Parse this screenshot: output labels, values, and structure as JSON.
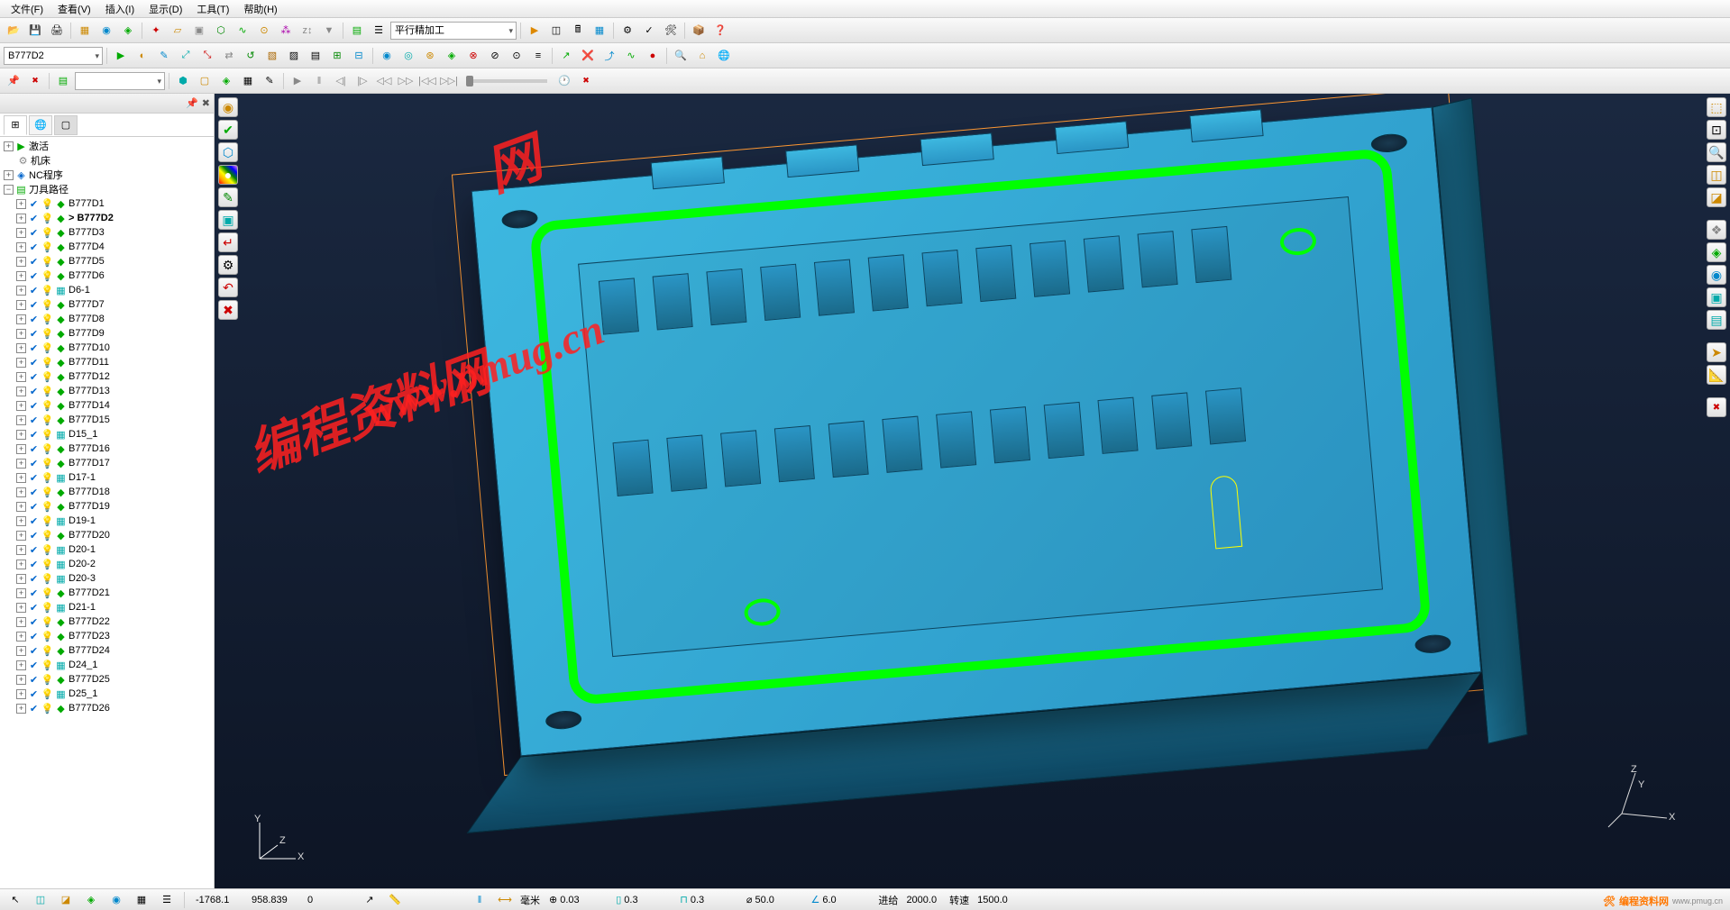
{
  "menu": {
    "file": "文件(F)",
    "view": "查看(V)",
    "insert": "插入(I)",
    "display": "显示(D)",
    "tools": "工具(T)",
    "help": "帮助(H)"
  },
  "toolbar2": {
    "combo1": "B777D2",
    "combo_strategy": "平行精加工"
  },
  "explorer": {
    "roots": {
      "activate": "激活",
      "machine": "机床",
      "nc": "NC程序",
      "toolpath": "刀具路径"
    },
    "active_path": "> B777D2",
    "items": [
      "B777D1",
      "B777D2",
      "B777D3",
      "B777D4",
      "B777D5",
      "B777D6",
      "D6-1",
      "B777D7",
      "B777D8",
      "B777D9",
      "B777D10",
      "B777D11",
      "B777D12",
      "B777D13",
      "B777D14",
      "B777D15",
      "D15_1",
      "B777D16",
      "B777D17",
      "D17-1",
      "B777D18",
      "B777D19",
      "D19-1",
      "B777D20",
      "D20-1",
      "D20-2",
      "D20-3",
      "B777D21",
      "D21-1",
      "B777D22",
      "B777D23",
      "B777D24",
      "D24_1",
      "B777D25",
      "D25_1",
      "B777D26"
    ]
  },
  "status": {
    "x": "-1768.1",
    "y": "958.839",
    "z": "0",
    "unit": "毫米",
    "tol": "0.03",
    "st": "0.3",
    "cup": "0.3",
    "dia": "50.0",
    "ang": "6.0",
    "feed_label": "进给",
    "feed": "2000.0",
    "speed_label": "转速",
    "speed": "1500.0"
  },
  "watermark": {
    "url": "www.pmug.cn",
    "text": "编程资料网"
  },
  "brand": {
    "title": "编程资料网",
    "url": "www.pmug.cn"
  },
  "axes": {
    "x": "X",
    "y": "Y",
    "z": "Z"
  }
}
